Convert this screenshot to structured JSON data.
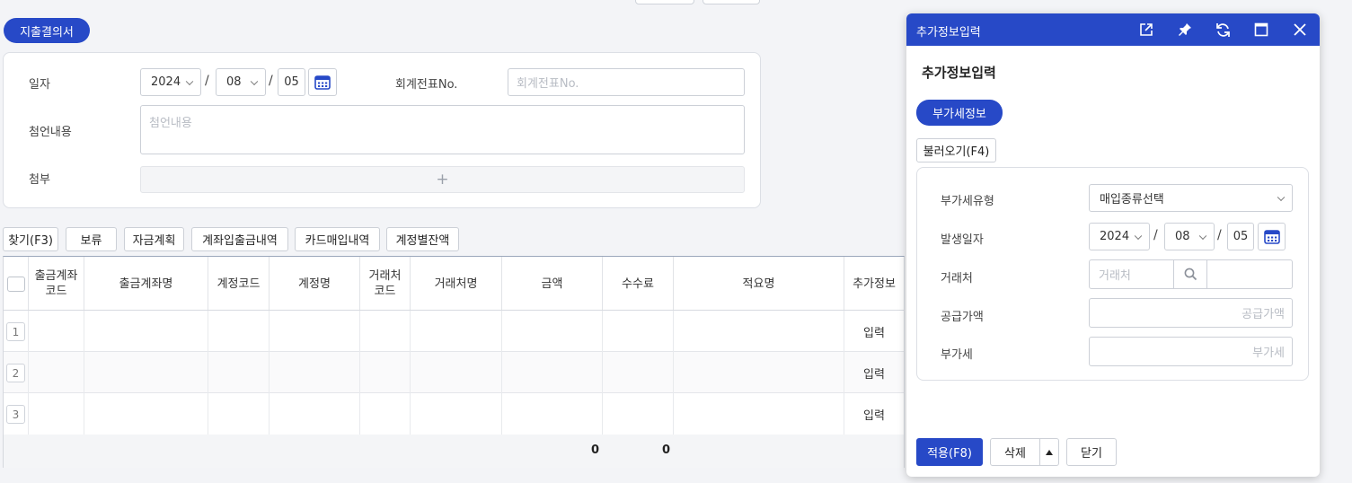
{
  "page": {
    "chip_label": "지출결의서"
  },
  "form": {
    "date_label": "일자",
    "year": "2024",
    "month": "08",
    "day": "05",
    "voucher_label": "회계전표No.",
    "voucher_placeholder": "회계전표No.",
    "remark_label": "첨언내용",
    "remark_placeholder": "첨언내용",
    "attach_label": "첨부",
    "attach_plus": "+"
  },
  "toolbar": {
    "find": "찾기(F3)",
    "hold": "보류",
    "fund_plan": "자금계획",
    "account_history": "계좌입출금내역",
    "card_history": "카드매입내역",
    "account_balance": "계정별잔액"
  },
  "table": {
    "headers": [
      "출금계좌\n코드",
      "출금계좌명",
      "계정코드",
      "계정명",
      "거래처\n코드",
      "거래처명",
      "금액",
      "수수료",
      "적요명",
      "추가정보"
    ],
    "rows": [
      {
        "num": "1",
        "action": "입력"
      },
      {
        "num": "2",
        "action": "입력"
      },
      {
        "num": "3",
        "action": "입력"
      }
    ],
    "sum_amount": "0",
    "sum_fee": "0"
  },
  "modal": {
    "title": "추가정보입력",
    "heading": "추가정보입력",
    "chip_label": "부가세정보",
    "load_button": "불러오기(F4)",
    "vat_type_label": "부가세유형",
    "vat_type_value": "매입종류선택",
    "date_label": "발생일자",
    "year": "2024",
    "month": "08",
    "day": "05",
    "partner_label": "거래처",
    "partner_placeholder": "거래처",
    "supply_label": "공급가액",
    "supply_placeholder": "공급가액",
    "vat_label": "부가세",
    "vat_placeholder": "부가세",
    "apply_button": "적용(F8)",
    "delete_button": "삭제",
    "close_button": "닫기"
  },
  "colors": {
    "accent": "#2749c7"
  }
}
